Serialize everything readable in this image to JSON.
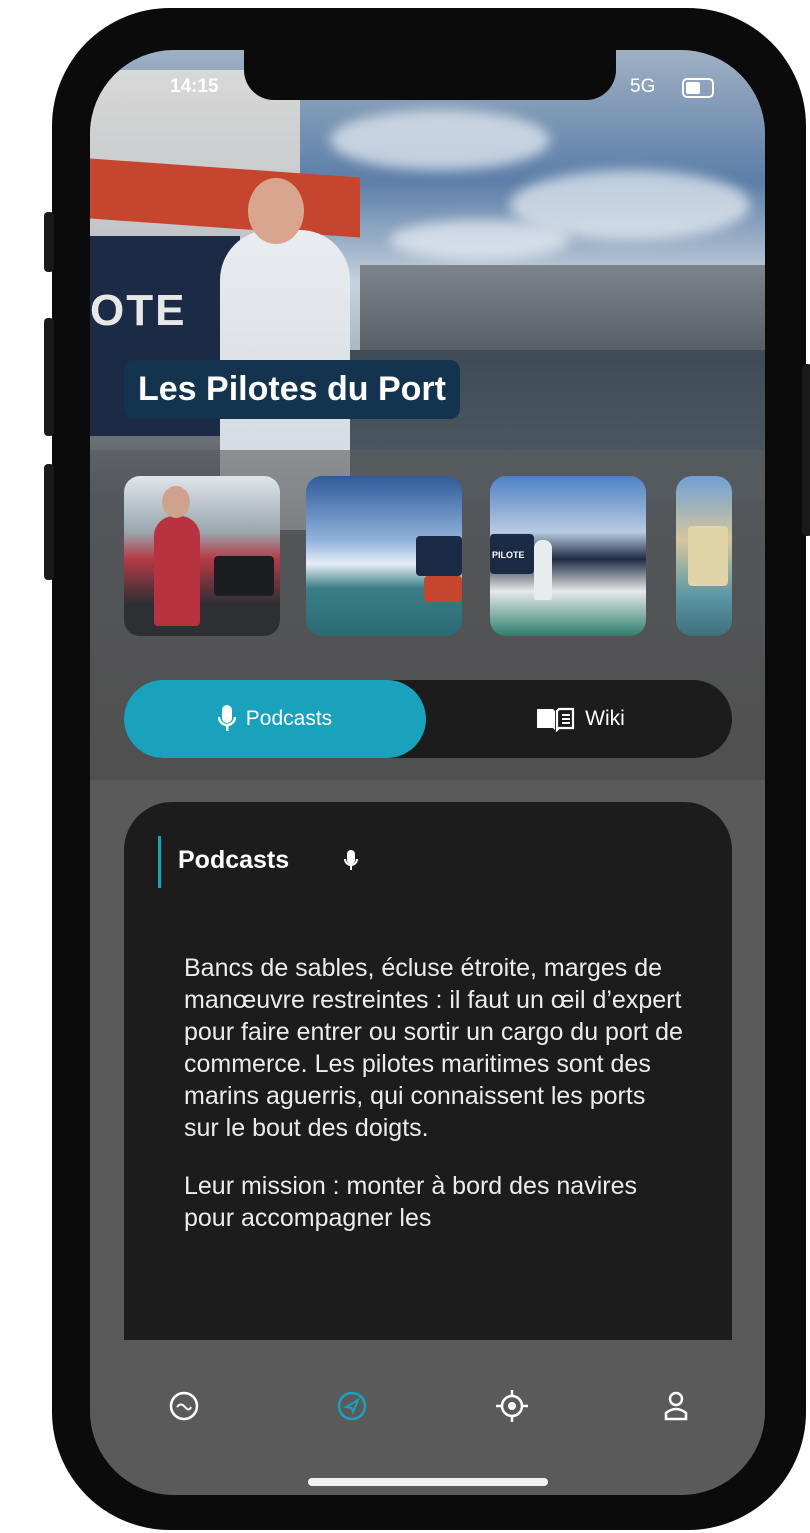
{
  "status_bar": {
    "time": "14:15",
    "network": "5G"
  },
  "header": {
    "title": "Les Pilotes du Port"
  },
  "gallery": {
    "images": [
      {
        "alt": "pilot-at-helm"
      },
      {
        "alt": "pilot-boat-harbor"
      },
      {
        "alt": "pilot-on-deck"
      },
      {
        "alt": "harbor-silos"
      }
    ],
    "boat_lettering": "OTE",
    "thumb_lettering": "PILOTE"
  },
  "tabs": [
    {
      "label": "Podcasts",
      "icon": "microphone-icon",
      "active": true
    },
    {
      "label": "Wiki",
      "icon": "book-icon",
      "active": false
    }
  ],
  "section": {
    "title": "Podcasts",
    "icon": "microphone-icon",
    "paragraphs": [
      "Bancs de sables, écluse étroite, marges de manœuvre restreintes : il faut un œil d’expert pour faire entrer ou sortir un cargo du port de commerce. Les pilotes maritimes sont des marins aguerris, qui connaissent les ports sur le bout des doigts.",
      "Leur mission : monter à bord des navires pour accompagner les"
    ]
  },
  "bottom_nav": [
    {
      "name": "home",
      "icon": "logo-badge-icon",
      "active": false
    },
    {
      "name": "explore",
      "icon": "compass-icon",
      "active": true
    },
    {
      "name": "location",
      "icon": "target-location-icon",
      "active": false
    },
    {
      "name": "profile",
      "icon": "user-icon",
      "active": false
    }
  ],
  "colors": {
    "accent": "#1aa2bd",
    "title_badge": "#13334e",
    "card_bg": "#1c1c1c",
    "nav_bg": "#5a5a5a"
  }
}
